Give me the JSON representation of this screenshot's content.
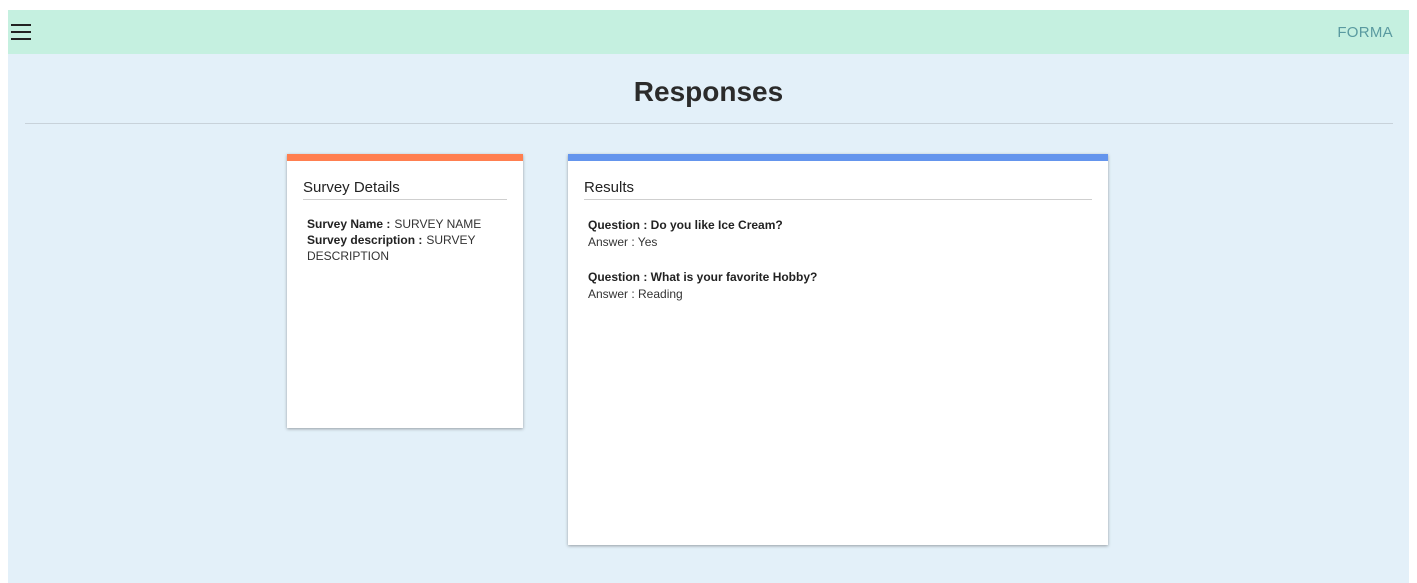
{
  "header": {
    "brand": "FORMA",
    "menu_icon": "hamburger-menu-icon"
  },
  "page": {
    "title": "Responses"
  },
  "details": {
    "heading": "Survey Details",
    "name_label": "Survey Name :",
    "name_value": "SURVEY NAME",
    "description_label": "Survey description :",
    "description_value": "SURVEY DESCRIPTION"
  },
  "results": {
    "heading": "Results",
    "items": [
      {
        "question": "Question : Do you like Ice Cream?",
        "answer": "Answer : Yes"
      },
      {
        "question": "Question : What is your favorite Hobby?",
        "answer": "Answer : Reading"
      }
    ]
  },
  "colors": {
    "topbar": "#c5f0e0",
    "background": "#e3f0f9",
    "details_accent": "#ff7f50",
    "results_accent": "#6495ed",
    "brand_text": "#5a9aa0"
  }
}
